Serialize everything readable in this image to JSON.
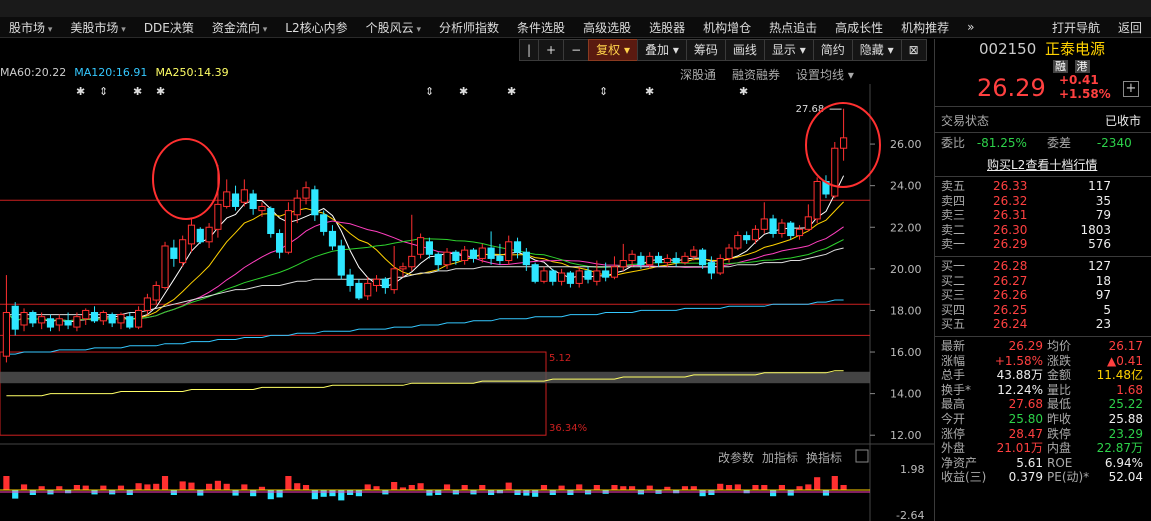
{
  "menu": {
    "items": [
      {
        "label": "股市场",
        "caret": true
      },
      {
        "label": "美股市场",
        "caret": true
      },
      {
        "label": "DDE决策",
        "caret": false
      },
      {
        "label": "资金流向",
        "caret": true
      },
      {
        "label": "L2核心内参",
        "caret": false
      },
      {
        "label": "个股风云",
        "caret": true
      },
      {
        "label": "分析师指数",
        "caret": false
      },
      {
        "label": "条件选股",
        "caret": false
      },
      {
        "label": "高级选股",
        "caret": false
      },
      {
        "label": "选股器",
        "caret": false
      },
      {
        "label": "机构增仓",
        "caret": false
      },
      {
        "label": "热点追击",
        "caret": false
      },
      {
        "label": "高成长性",
        "caret": false
      },
      {
        "label": "机构推荐",
        "caret": false
      }
    ],
    "more": "»",
    "right": [
      "打开导航",
      "返回"
    ]
  },
  "toolbar": {
    "buttons": [
      "|",
      "+",
      "−",
      "复权 ▾",
      "叠加 ▾",
      "筹码",
      "画线",
      "显示 ▾",
      "简约",
      "隐藏 ▾",
      "⊠"
    ],
    "active_index": 3
  },
  "legend": [
    {
      "text": "MA60:20.22",
      "color": "#cccccc"
    },
    {
      "text": "MA120:16.91",
      "color": "#34c8ff"
    },
    {
      "text": "MA250:14.39",
      "color": "#ffff66"
    }
  ],
  "sublinks": [
    "深股通",
    "融资融券",
    "设置均线 ▾"
  ],
  "chart_data": {
    "type": "candlestick",
    "price_axis": {
      "ticks": [
        26.0,
        24.0,
        22.0,
        20.0,
        18.0,
        16.0,
        14.0,
        12.0
      ],
      "range": [
        11.0,
        28.6
      ]
    },
    "peak_label": "27.68",
    "box_labels": {
      "top": "5.12",
      "bottom": "36.34%"
    },
    "candles": [
      [
        15.8,
        17.9,
        15.5,
        19.7
      ],
      [
        18.2,
        17.1,
        16.8,
        18.4
      ],
      [
        17.3,
        17.9,
        17.0,
        18.1
      ],
      [
        17.9,
        17.4,
        17.2,
        18.0
      ],
      [
        17.4,
        17.7,
        17.1,
        17.9
      ],
      [
        17.6,
        17.2,
        17.0,
        17.8
      ],
      [
        17.3,
        17.6,
        17.0,
        17.8
      ],
      [
        17.5,
        17.3,
        17.1,
        17.9
      ],
      [
        17.2,
        17.7,
        17.0,
        17.9
      ],
      [
        17.6,
        18.0,
        17.3,
        18.1
      ],
      [
        17.9,
        17.5,
        17.4,
        18.2
      ],
      [
        17.5,
        17.9,
        17.3,
        18.0
      ],
      [
        17.8,
        17.4,
        17.2,
        17.9
      ],
      [
        17.4,
        17.8,
        17.1,
        17.9
      ],
      [
        17.7,
        17.2,
        17.1,
        17.9
      ],
      [
        17.2,
        18.0,
        17.1,
        18.2
      ],
      [
        18.0,
        18.6,
        17.8,
        18.8
      ],
      [
        18.5,
        19.2,
        18.3,
        19.4
      ],
      [
        19.1,
        21.1,
        19.0,
        21.3
      ],
      [
        21.0,
        20.5,
        20.1,
        21.4
      ],
      [
        20.3,
        21.4,
        20.1,
        21.6
      ],
      [
        21.2,
        22.1,
        20.8,
        22.4
      ],
      [
        21.9,
        21.3,
        21.2,
        22.0
      ],
      [
        21.3,
        22.0,
        21.0,
        22.2
      ],
      [
        21.9,
        23.1,
        21.5,
        25.0
      ],
      [
        23.0,
        23.7,
        22.9,
        24.3
      ],
      [
        23.6,
        23.0,
        22.8,
        24.0
      ],
      [
        23.2,
        23.8,
        23.0,
        24.3
      ],
      [
        23.6,
        22.9,
        22.6,
        23.8
      ],
      [
        22.8,
        23.0,
        22.5,
        23.2
      ],
      [
        22.9,
        21.7,
        21.5,
        23.0
      ],
      [
        21.7,
        20.8,
        20.5,
        21.9
      ],
      [
        20.8,
        22.8,
        20.7,
        23.2
      ],
      [
        22.6,
        23.4,
        22.2,
        23.8
      ],
      [
        23.4,
        23.9,
        23.1,
        24.2
      ],
      [
        23.8,
        22.6,
        22.3,
        24.0
      ],
      [
        22.6,
        21.8,
        21.6,
        22.8
      ],
      [
        21.8,
        21.1,
        20.9,
        22.1
      ],
      [
        21.1,
        19.7,
        19.5,
        21.4
      ],
      [
        19.7,
        19.2,
        18.9,
        20.0
      ],
      [
        19.3,
        18.6,
        18.5,
        19.5
      ],
      [
        18.7,
        19.3,
        18.5,
        19.6
      ],
      [
        19.2,
        19.5,
        18.9,
        19.7
      ],
      [
        19.5,
        19.1,
        18.8,
        19.6
      ],
      [
        19.0,
        20.0,
        18.8,
        21.1
      ],
      [
        20.0,
        20.1,
        19.6,
        20.3
      ],
      [
        20.1,
        20.6,
        19.9,
        22.6
      ],
      [
        20.7,
        21.5,
        20.5,
        21.7
      ],
      [
        21.3,
        20.7,
        20.5,
        21.5
      ],
      [
        20.7,
        20.2,
        19.9,
        20.8
      ],
      [
        20.2,
        20.8,
        20.0,
        21.0
      ],
      [
        20.8,
        20.4,
        20.2,
        20.9
      ],
      [
        20.4,
        20.9,
        20.2,
        21.1
      ],
      [
        20.9,
        20.5,
        20.3,
        21.0
      ],
      [
        20.5,
        21.0,
        20.3,
        21.2
      ],
      [
        21.0,
        20.5,
        20.2,
        21.8
      ],
      [
        20.6,
        20.4,
        20.2,
        21.2
      ],
      [
        20.4,
        21.3,
        20.2,
        21.6
      ],
      [
        21.3,
        20.8,
        20.5,
        21.5
      ],
      [
        20.8,
        20.2,
        19.9,
        21.0
      ],
      [
        20.2,
        19.4,
        19.3,
        20.3
      ],
      [
        19.4,
        19.9,
        19.3,
        20.1
      ],
      [
        19.9,
        19.4,
        19.2,
        20.0
      ],
      [
        19.4,
        19.8,
        19.2,
        20.0
      ],
      [
        19.8,
        19.3,
        19.1,
        19.9
      ],
      [
        19.3,
        19.9,
        19.1,
        20.1
      ],
      [
        19.9,
        19.5,
        19.3,
        20.1
      ],
      [
        19.4,
        19.9,
        19.2,
        20.4
      ],
      [
        19.9,
        19.6,
        19.4,
        20.3
      ],
      [
        19.6,
        20.1,
        19.5,
        20.6
      ],
      [
        20.1,
        20.4,
        19.9,
        21.2
      ],
      [
        20.4,
        20.7,
        20.1,
        20.9
      ],
      [
        20.6,
        20.2,
        20.0,
        20.8
      ],
      [
        20.2,
        20.6,
        20.0,
        20.8
      ],
      [
        20.6,
        20.3,
        20.1,
        20.8
      ],
      [
        20.3,
        20.5,
        20.1,
        20.7
      ],
      [
        20.5,
        20.3,
        20.1,
        20.8
      ],
      [
        20.3,
        20.6,
        20.2,
        20.8
      ],
      [
        20.6,
        20.9,
        20.4,
        21.1
      ],
      [
        20.9,
        20.2,
        20.0,
        21.0
      ],
      [
        20.3,
        19.8,
        19.5,
        20.6
      ],
      [
        19.8,
        20.5,
        19.7,
        20.7
      ],
      [
        20.5,
        21.0,
        20.3,
        21.2
      ],
      [
        21.0,
        21.6,
        20.9,
        21.8
      ],
      [
        21.6,
        21.4,
        21.2,
        21.8
      ],
      [
        21.4,
        21.9,
        21.2,
        22.1
      ],
      [
        21.9,
        22.4,
        21.7,
        23.2
      ],
      [
        22.4,
        21.7,
        21.5,
        22.6
      ],
      [
        21.7,
        22.2,
        21.5,
        22.4
      ],
      [
        22.2,
        21.6,
        21.4,
        22.3
      ],
      [
        21.6,
        21.9,
        21.4,
        22.1
      ],
      [
        21.9,
        22.5,
        21.8,
        23.1
      ],
      [
        22.4,
        24.2,
        22.2,
        24.4
      ],
      [
        24.2,
        23.6,
        23.4,
        24.5
      ],
      [
        23.5,
        25.8,
        23.4,
        26.1
      ],
      [
        25.8,
        26.3,
        25.2,
        27.7
      ]
    ],
    "ma_series": [
      {
        "name": "MA60",
        "color": "#dddddd",
        "values": [
          17.8,
          17.8,
          17.8,
          17.8,
          17.8,
          17.8,
          17.8,
          17.8,
          17.8,
          17.8,
          17.8,
          17.8,
          17.8,
          17.8,
          17.9,
          17.9,
          18.0,
          18.1,
          18.2,
          18.3,
          18.4,
          18.5,
          18.6,
          18.7,
          18.8,
          18.9,
          19.0,
          19.0,
          19.1,
          19.2,
          19.2,
          19.2,
          19.3,
          19.4,
          19.4,
          19.5,
          19.5,
          19.5,
          19.5,
          19.5,
          19.5,
          19.5,
          19.5,
          19.5,
          19.6,
          19.6,
          19.7,
          19.8,
          19.8,
          19.9,
          19.9,
          20.0,
          20.0,
          20.0,
          20.1,
          20.1,
          20.1,
          20.1,
          20.1,
          20.1,
          20.1,
          20.1,
          20.1,
          20.1,
          20.1,
          20.1,
          20.1,
          20.1,
          20.1,
          20.1,
          20.1,
          20.1,
          20.1,
          20.1,
          20.1,
          20.1,
          20.1,
          20.1,
          20.1,
          20.1,
          20.1,
          20.1,
          20.1,
          20.2,
          20.2,
          20.2,
          20.3,
          20.3,
          20.3,
          20.4,
          20.4,
          20.5,
          20.6,
          20.7,
          20.9,
          21.0
        ]
      },
      {
        "name": "MA120",
        "color": "#34c8ff",
        "values": [
          15.9,
          15.9,
          16.0,
          16.0,
          16.0,
          16.0,
          16.1,
          16.1,
          16.1,
          16.1,
          16.2,
          16.2,
          16.2,
          16.2,
          16.3,
          16.3,
          16.3,
          16.3,
          16.4,
          16.4,
          16.4,
          16.5,
          16.5,
          16.5,
          16.6,
          16.6,
          16.6,
          16.7,
          16.7,
          16.7,
          16.8,
          16.8,
          16.8,
          16.9,
          16.9,
          16.9,
          17.0,
          17.0,
          17.0,
          17.0,
          17.1,
          17.1,
          17.1,
          17.1,
          17.2,
          17.2,
          17.2,
          17.3,
          17.3,
          17.3,
          17.4,
          17.4,
          17.4,
          17.5,
          17.5,
          17.5,
          17.6,
          17.6,
          17.6,
          17.6,
          17.7,
          17.7,
          17.7,
          17.7,
          17.8,
          17.8,
          17.8,
          17.8,
          17.9,
          17.9,
          17.9,
          17.9,
          18.0,
          18.0,
          18.0,
          18.0,
          18.0,
          18.1,
          18.1,
          18.1,
          18.1,
          18.1,
          18.2,
          18.2,
          18.2,
          18.2,
          18.2,
          18.3,
          18.3,
          18.3,
          18.3,
          18.3,
          18.4,
          18.4,
          18.5,
          18.5
        ]
      },
      {
        "name": "MA250",
        "color": "#ffff66",
        "values": [
          13.9,
          13.9,
          13.9,
          13.9,
          13.9,
          14.0,
          14.0,
          14.0,
          14.0,
          14.0,
          14.0,
          14.0,
          14.0,
          14.1,
          14.1,
          14.1,
          14.1,
          14.1,
          14.1,
          14.1,
          14.1,
          14.2,
          14.2,
          14.2,
          14.2,
          14.2,
          14.2,
          14.2,
          14.2,
          14.3,
          14.3,
          14.3,
          14.3,
          14.3,
          14.3,
          14.3,
          14.3,
          14.4,
          14.4,
          14.4,
          14.4,
          14.4,
          14.4,
          14.4,
          14.4,
          14.4,
          14.5,
          14.5,
          14.5,
          14.5,
          14.5,
          14.5,
          14.5,
          14.5,
          14.6,
          14.6,
          14.6,
          14.6,
          14.6,
          14.6,
          14.6,
          14.6,
          14.7,
          14.7,
          14.7,
          14.7,
          14.7,
          14.7,
          14.7,
          14.7,
          14.8,
          14.8,
          14.8,
          14.8,
          14.8,
          14.8,
          14.8,
          14.8,
          14.9,
          14.9,
          14.9,
          14.9,
          14.9,
          14.9,
          14.9,
          14.9,
          15.0,
          15.0,
          15.0,
          15.0,
          15.0,
          15.0,
          15.0,
          15.0,
          15.1,
          15.1
        ]
      }
    ],
    "indicator": {
      "ticks": [
        "1.98",
        "-2.64"
      ]
    }
  },
  "lower_links": [
    "改参数",
    "加指标",
    "换指标"
  ],
  "stock": {
    "code": "002150",
    "name": "正泰电源",
    "tags": [
      "融",
      "港"
    ],
    "price": "26.29",
    "change": "+0.41",
    "change_pct": "+1.58%",
    "status_label": "交易状态",
    "status_value": "已收市",
    "webi_label": "委比",
    "webi_value": "-81.25%",
    "weicha_label": "委差",
    "weicha_value": "-2340",
    "l2_link": "购买L2查看十档行情",
    "asks": [
      {
        "label": "卖五",
        "price": "26.33",
        "vol": "117"
      },
      {
        "label": "卖四",
        "price": "26.32",
        "vol": "35"
      },
      {
        "label": "卖三",
        "price": "26.31",
        "vol": "79"
      },
      {
        "label": "卖二",
        "price": "26.30",
        "vol": "1803"
      },
      {
        "label": "卖一",
        "price": "26.29",
        "vol": "576"
      }
    ],
    "bids": [
      {
        "label": "买一",
        "price": "26.28",
        "vol": "127"
      },
      {
        "label": "买二",
        "price": "26.27",
        "vol": "18"
      },
      {
        "label": "买三",
        "price": "26.26",
        "vol": "97"
      },
      {
        "label": "买四",
        "price": "26.25",
        "vol": "5"
      },
      {
        "label": "买五",
        "price": "26.24",
        "vol": "23"
      }
    ],
    "stats": [
      [
        {
          "label": "最新",
          "value": "26.29",
          "cls": "red"
        },
        {
          "label": "均价",
          "value": "26.17",
          "cls": "red"
        }
      ],
      [
        {
          "label": "涨幅",
          "value": "+1.58%",
          "cls": "red"
        },
        {
          "label": "涨跌",
          "value": "▲0.41",
          "cls": "red"
        }
      ],
      [
        {
          "label": "总手",
          "value": "43.88万",
          "cls": "white"
        },
        {
          "label": "金额",
          "value": "11.48亿",
          "cls": "yellow"
        }
      ],
      [
        {
          "label": "换手*",
          "value": "12.24%",
          "cls": "white"
        },
        {
          "label": "量比",
          "value": "1.68",
          "cls": "red"
        }
      ],
      [
        {
          "label": "最高",
          "value": "27.68",
          "cls": "red"
        },
        {
          "label": "最低",
          "value": "25.22",
          "cls": "green"
        }
      ],
      [
        {
          "label": "今开",
          "value": "25.80",
          "cls": "green"
        },
        {
          "label": "昨收",
          "value": "25.88",
          "cls": "white"
        }
      ],
      [
        {
          "label": "涨停",
          "value": "28.47",
          "cls": "red"
        },
        {
          "label": "跌停",
          "value": "23.29",
          "cls": "green"
        }
      ],
      [
        {
          "label": "外盘",
          "value": "21.01万",
          "cls": "red"
        },
        {
          "label": "内盘",
          "value": "22.87万",
          "cls": "green"
        }
      ],
      [
        {
          "label": "净资产",
          "value": "5.61",
          "cls": "white"
        },
        {
          "label": "ROE",
          "value": "6.94%",
          "cls": "white"
        }
      ],
      [
        {
          "label": "收益(三)",
          "value": "0.379",
          "cls": "white"
        },
        {
          "label": "PE(动)*",
          "value": "52.04",
          "cls": "white"
        }
      ]
    ]
  },
  "colors": {
    "up": "#ff3030",
    "down": "#2ee6ff",
    "circle": "#ff3030"
  }
}
